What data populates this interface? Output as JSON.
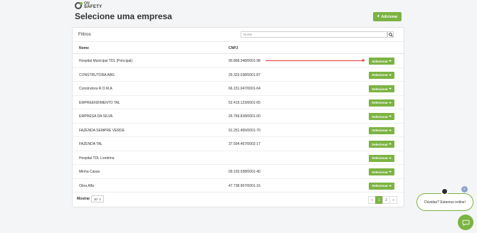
{
  "logo": {
    "line1": "ON",
    "line2": "SAFETY"
  },
  "header": {
    "title": "Selecione uma empresa",
    "add_label": "Adicionar"
  },
  "filters": {
    "label": "Filtros",
    "search_placeholder": "Nome"
  },
  "table": {
    "columns": {
      "name": "Nome",
      "cnpj": "CNPJ"
    },
    "select_label": "Selecionar",
    "rows": [
      {
        "name": "Hospital Municipal TDL (Principal)",
        "cnpj": "90.868.348/0001-98"
      },
      {
        "name": "CONSTRUTORA ABG",
        "cnpj": "29.323.038/0001-87"
      },
      {
        "name": "Construtora R.O.M.A",
        "cnpj": "66.151.047/0001-64"
      },
      {
        "name": "EMPREENDIMENTO TAL",
        "cnpj": "52.419.123/0001-65"
      },
      {
        "name": "EMPRESA DA SILVA",
        "cnpj": "26.769.828/0001-00"
      },
      {
        "name": "FAZENDA SEMPRE VERDE",
        "cnpj": "91.251.465/0001-70"
      },
      {
        "name": "FAZENDA TAL",
        "cnpj": "37.594.467/0002-17"
      },
      {
        "name": "Hospital TDL Londrina",
        "cnpj": ""
      },
      {
        "name": "Minha Casas",
        "cnpj": "09.193.938/0001-40"
      },
      {
        "name": "Obra Alfa",
        "cnpj": "47.738.907/0001-16"
      }
    ]
  },
  "footer": {
    "show_label": "Mostrar",
    "page_size": "10"
  },
  "pagination": {
    "prev": "«",
    "pages": [
      "1",
      "2"
    ],
    "next": "»",
    "current": "1"
  },
  "chat": {
    "message": "Dúvidas? Estamos online!",
    "close": "×"
  },
  "colors": {
    "accent": "#7cb342",
    "annotation": "#e53935"
  }
}
